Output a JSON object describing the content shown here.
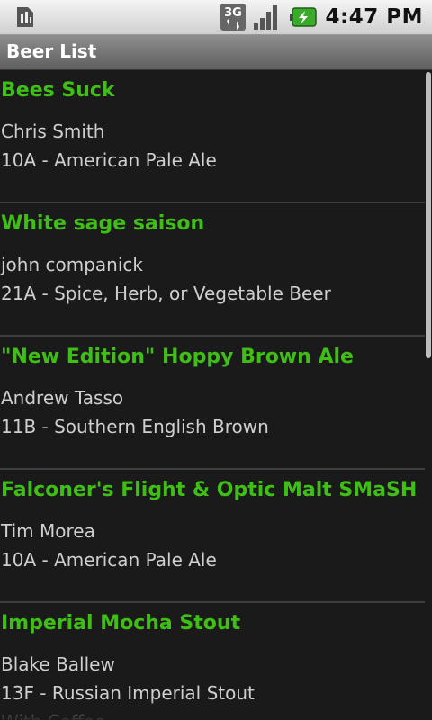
{
  "status_bar": {
    "time": "4:47 PM",
    "network_badge": "3G",
    "icons": [
      "sim-card-icon",
      "network-3g-icon",
      "signal-strength-icon",
      "battery-charging-icon"
    ]
  },
  "app": {
    "title": "Beer List"
  },
  "colors": {
    "beer_name": "#3fbf16",
    "secondary_text": "#cfcfcf",
    "background": "#1a1a1a"
  },
  "beers": [
    {
      "name": "Bees Suck",
      "brewer": "Chris Smith",
      "style": "10A - American Pale Ale"
    },
    {
      "name": "White sage saison",
      "brewer": "john companick",
      "style": "21A - Spice, Herb, or Vegetable Beer"
    },
    {
      "name": "\"New Edition\" Hoppy Brown Ale",
      "brewer": "Andrew Tasso",
      "style": "11B - Southern English Brown"
    },
    {
      "name": "Falconer's Flight & Optic Malt SMaSH",
      "brewer": "Tim Morea",
      "style": "10A - American Pale Ale"
    },
    {
      "name": "Imperial Mocha Stout",
      "brewer": "Blake Ballew",
      "style": "13F - Russian Imperial Stout",
      "extra": "With Coffee"
    }
  ]
}
